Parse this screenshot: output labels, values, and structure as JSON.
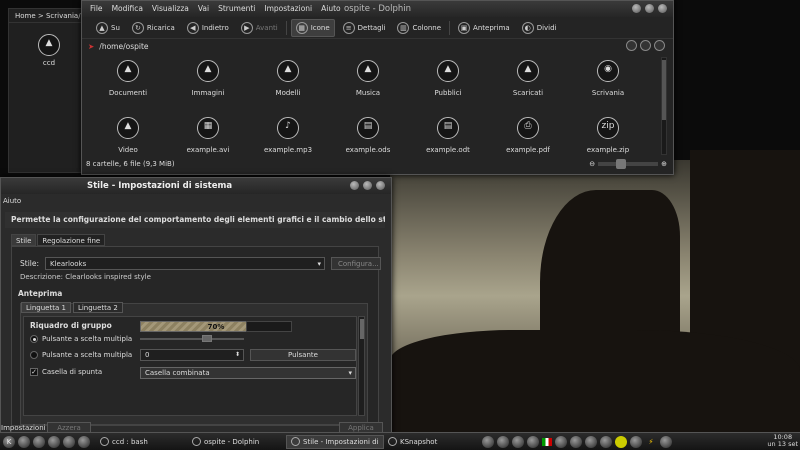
{
  "desktop": {
    "breadcrumb": "Home > Scrivania/",
    "item_label": "ccd"
  },
  "dolphin": {
    "title": "ospite - Dolphin",
    "menu": [
      "File",
      "Modifica",
      "Visualizza",
      "Vai",
      "Strumenti",
      "Impostazioni",
      "Aiuto"
    ],
    "toolbar": {
      "up": "Su",
      "reload": "Ricarica",
      "back": "Indietro",
      "forward": "Avanti",
      "icons": "Icone",
      "details": "Dettagli",
      "columns": "Colonne",
      "preview": "Anteprima",
      "split": "Dividi"
    },
    "location": "/home/ospite",
    "files": [
      {
        "name": "Documenti",
        "glyph": "▲"
      },
      {
        "name": "Immagini",
        "glyph": "▲"
      },
      {
        "name": "Modelli",
        "glyph": "▲"
      },
      {
        "name": "Musica",
        "glyph": "▲"
      },
      {
        "name": "Pubblici",
        "glyph": "▲"
      },
      {
        "name": "Scaricati",
        "glyph": "▲"
      },
      {
        "name": "Scrivania",
        "glyph": "◉"
      },
      {
        "name": "Video",
        "glyph": "▲"
      },
      {
        "name": "example.avi",
        "glyph": "▦"
      },
      {
        "name": "example.mp3",
        "glyph": "♪"
      },
      {
        "name": "example.ods",
        "glyph": "▤"
      },
      {
        "name": "example.odt",
        "glyph": "▤"
      },
      {
        "name": "example.pdf",
        "glyph": "⎙"
      },
      {
        "name": "example.zip",
        "glyph": "zip"
      }
    ],
    "status": "8 cartelle, 6 file (9,3 MiB)"
  },
  "stile": {
    "title": "Stile - Impostazioni di sistema",
    "help": "Aiuto",
    "banner": "Permette la configurazione del comportamento degli elementi grafici e il cambio dello stile di l",
    "tabs": [
      "Stile",
      "Regolazione fine"
    ],
    "style_label": "Stile:",
    "style_value": "Klearlooks",
    "configure": "Configura...",
    "description": "Descrizione: Clearlooks inspired style",
    "preview_heading": "Anteprima",
    "inner_tabs": [
      "Linguetta 1",
      "Linguetta 2"
    ],
    "group_title": "Riquadro di gruppo",
    "progress": "70%",
    "progress_value": 0.7,
    "radio1": "Pulsante a scelta multipla",
    "radio2": "Pulsante a scelta multipla",
    "spin_value": "0",
    "button_label": "Pulsante",
    "checkbox": "Casella di spunta",
    "combo": "Casella combinata",
    "bottom_left": "Impostazioni predefinite",
    "bottom_reset": "Azzera",
    "bottom_apply": "Applica"
  },
  "taskbar": {
    "tasks": [
      {
        "label": "ccd : bash"
      },
      {
        "label": "ospite - Dolphin"
      },
      {
        "label": "Stile - Impostazioni di"
      },
      {
        "label": "KSnapshot"
      }
    ],
    "time": "10:08",
    "date": "un 13 set"
  }
}
